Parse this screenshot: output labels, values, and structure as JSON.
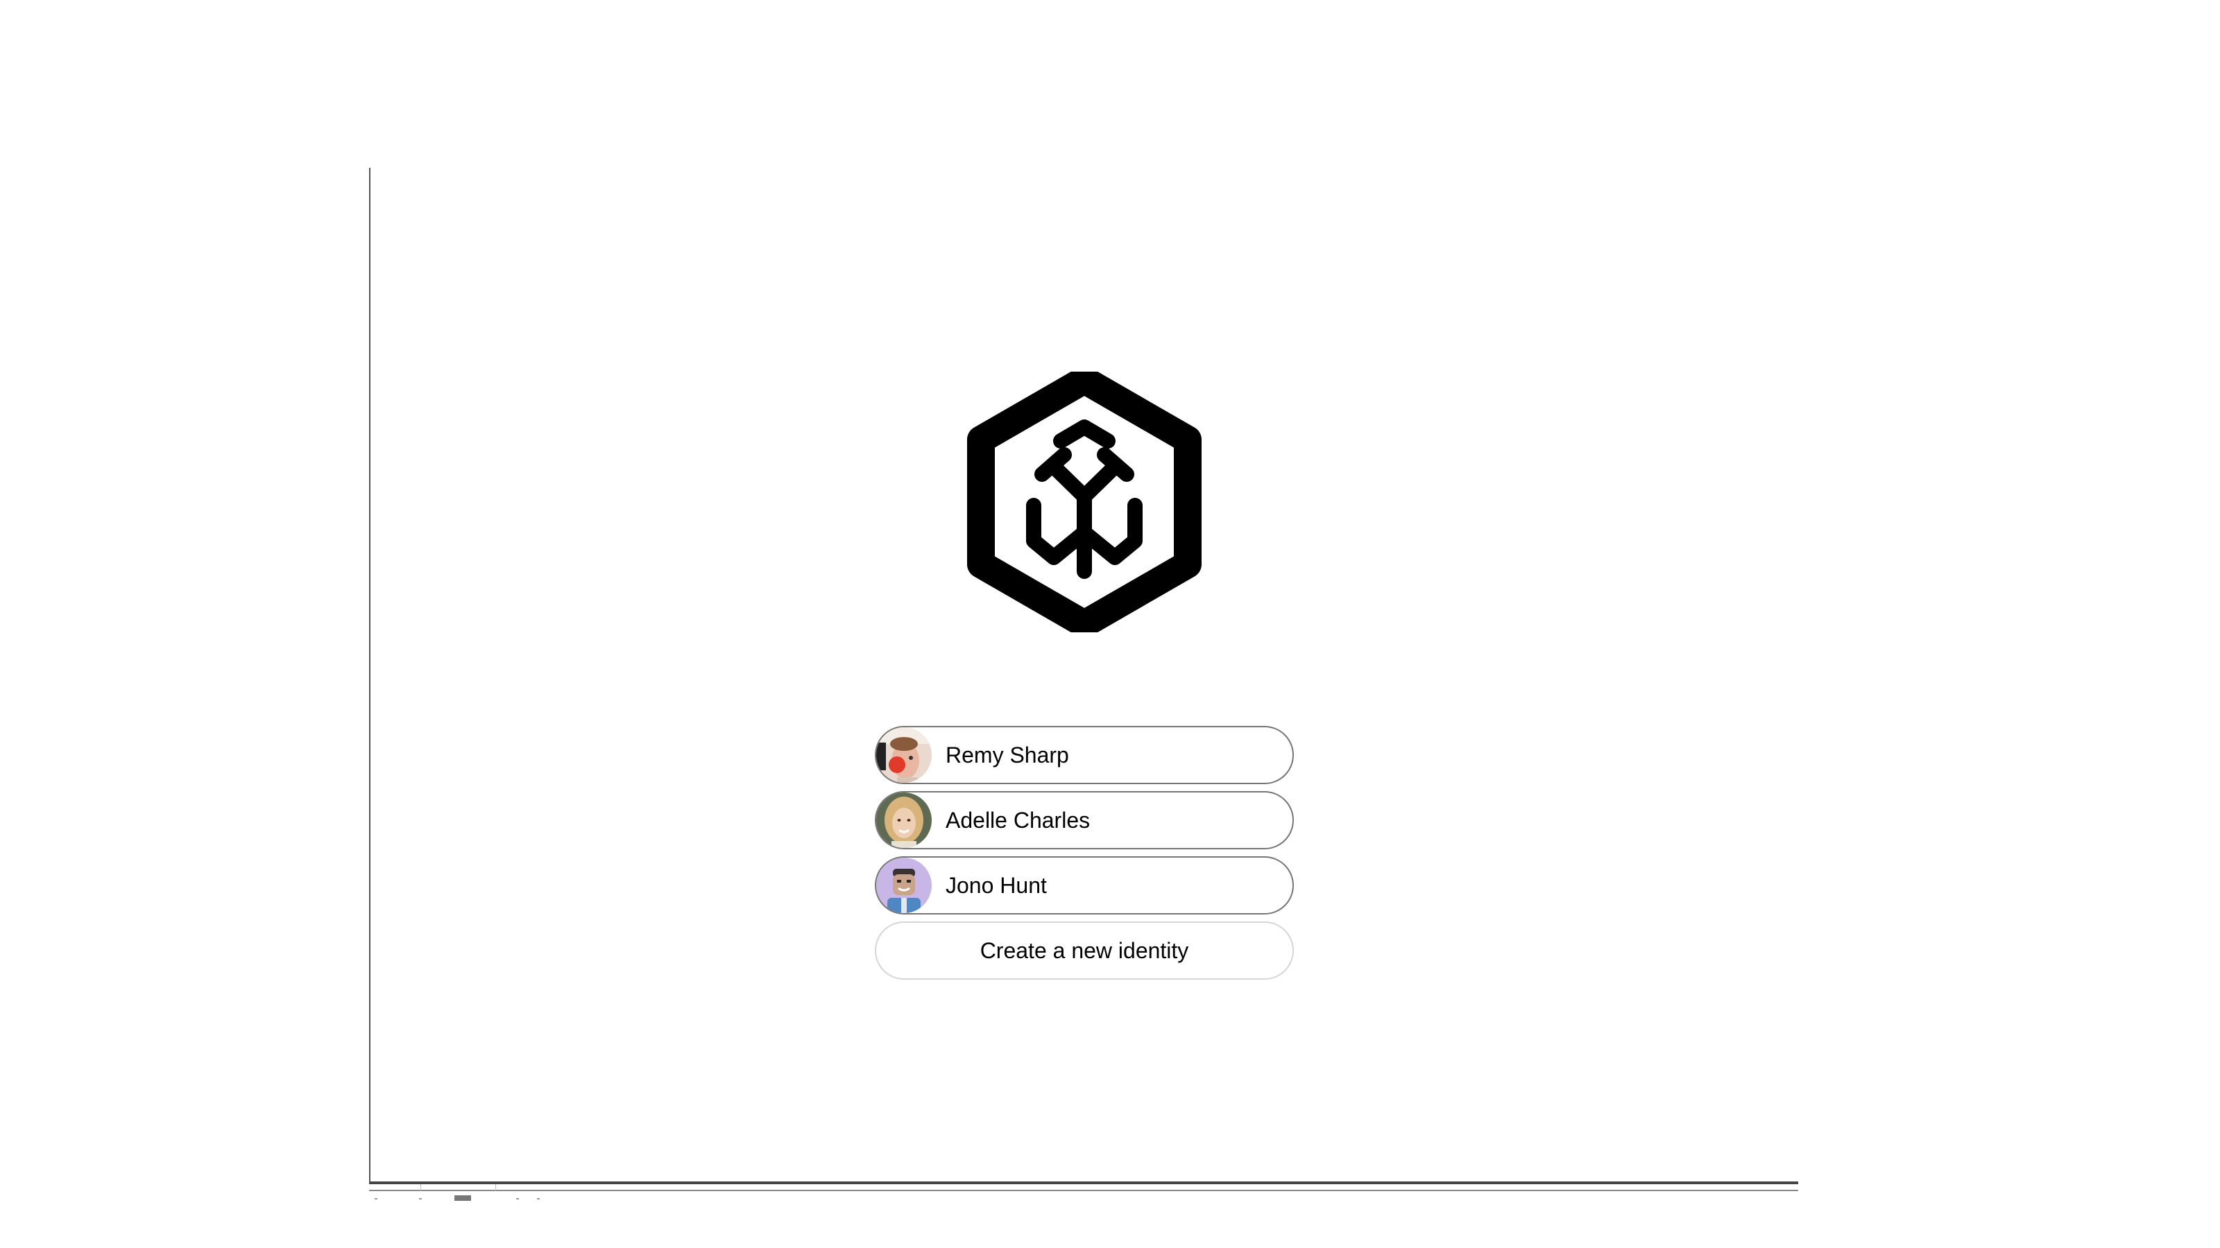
{
  "identities": [
    {
      "name": "Remy Sharp",
      "avatar_icon": "avatar-photo-remy-sharp"
    },
    {
      "name": "Adelle Charles",
      "avatar_icon": "avatar-photo-adelle-charles"
    },
    {
      "name": "Jono Hunt",
      "avatar_icon": "avatar-figurine-jono-hunt"
    }
  ],
  "create_identity_label": "Create a new identity",
  "logo_icon": "hexagon-tree-logo",
  "colors": {
    "logo": "#000000",
    "row_border": "#757575",
    "create_border": "#d6d6d6",
    "background": "#ffffff"
  }
}
